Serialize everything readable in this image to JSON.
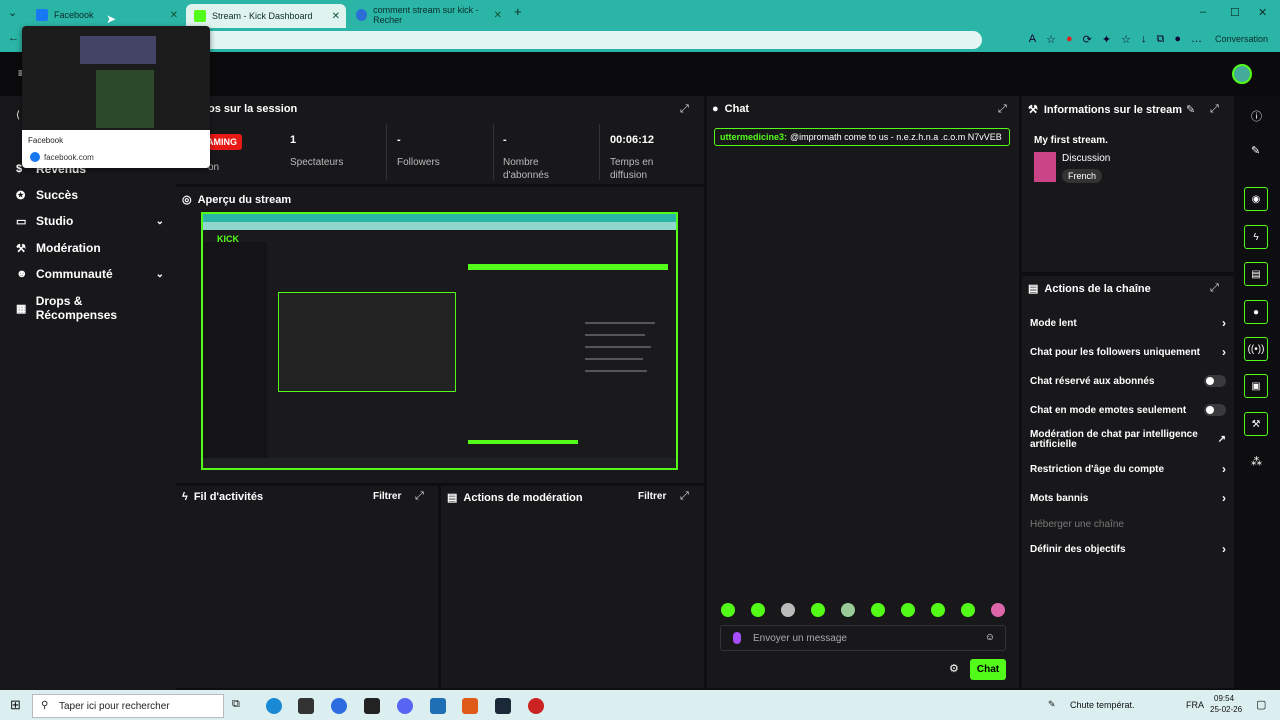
{
  "browser": {
    "tabs": [
      {
        "label": "Facebook"
      },
      {
        "label": "Stream - Kick Dashboard"
      },
      {
        "label": "comment stream sur kick - Recher"
      }
    ],
    "new_tab": "+",
    "conversation_label": "Conversation",
    "window_controls": {
      "min": "–",
      "max": "☐",
      "close": "✕"
    }
  },
  "tab_preview": {
    "title": "Facebook",
    "url": "facebook.com"
  },
  "sidebar": {
    "items": [
      {
        "label": "Revenus"
      },
      {
        "label": "Succès"
      },
      {
        "label": "Studio"
      },
      {
        "label": "Modération"
      },
      {
        "label": "Communauté"
      },
      {
        "label": "Drops & Récompenses"
      }
    ]
  },
  "session": {
    "title": "os sur la session",
    "live_badge": "AMING",
    "live_sub": "on",
    "stats": [
      {
        "value": "1",
        "label": "Spectateurs"
      },
      {
        "value": "-",
        "label": "Followers"
      },
      {
        "value": "-",
        "label": "Nombre d'abonnés"
      },
      {
        "value": "00:06:12",
        "label": "Temps en diffusion"
      }
    ]
  },
  "preview": {
    "title": "Aperçu du stream",
    "mini_logo": "KICK"
  },
  "activity": {
    "title": "Fil d'activités",
    "filter": "Filtrer"
  },
  "mod_actions": {
    "title": "Actions de modération",
    "filter": "Filtrer"
  },
  "chat": {
    "title": "Chat",
    "message_user": "uttermedicine3:",
    "message_text": "@impromath come to us - n.e.z.h.n.a .c.o.m N7vVEB",
    "input_placeholder": "Envoyer un message",
    "send_label": "Chat"
  },
  "stream_info": {
    "title": "Informations sur le stream",
    "stream_title": "My first stream.",
    "category": "Discussion",
    "language": "French"
  },
  "channel_actions": {
    "title": "Actions de la chaîne",
    "rows": [
      {
        "label": "Mode lent"
      },
      {
        "label": "Chat pour les followers uniquement"
      },
      {
        "label": "Chat réservé aux abonnés"
      },
      {
        "label": "Chat en mode emotes seulement"
      },
      {
        "label": "Modération de chat par intelligence artificielle"
      },
      {
        "label": "Restriction d'âge du compte"
      },
      {
        "label": "Mots bannis"
      },
      {
        "label": "Héberger une chaîne"
      },
      {
        "label": "Définir des objectifs"
      }
    ]
  },
  "taskbar": {
    "search_placeholder": "Taper ici pour rechercher",
    "weather": "Chute températ.",
    "lang": "FRA",
    "time": "09:54",
    "date": "25-02-26"
  },
  "colors": {
    "accent": "#53fc18",
    "live": "#e91916",
    "browser": "#2bb5a6"
  }
}
